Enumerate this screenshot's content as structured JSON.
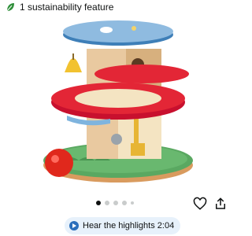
{
  "sustainability": {
    "label": "1 sustainability feature",
    "icon": "leaf-icon",
    "color": "#2f8f3a"
  },
  "product": {
    "image_icon": "wooden-toy-tower-image"
  },
  "carousel": {
    "dot_count": 5,
    "active_index": 0
  },
  "actions": {
    "heart_icon": "heart-outline-icon",
    "share_icon": "share-icon"
  },
  "highlights": {
    "label": "Hear the highlights 2:04",
    "accent": "#2a6ebb"
  }
}
